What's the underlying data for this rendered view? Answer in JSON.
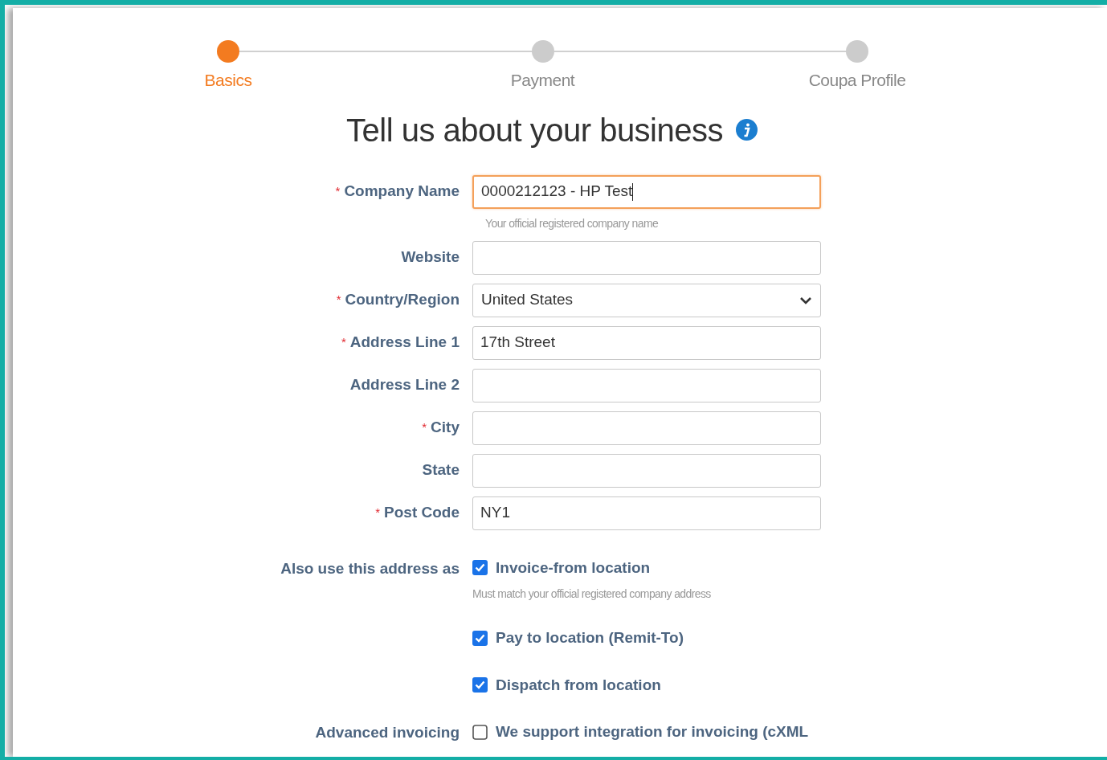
{
  "steps": [
    {
      "label": "Basics",
      "selected": true
    },
    {
      "label": "Payment",
      "selected": false
    },
    {
      "label": "Coupa Profile",
      "selected": false
    }
  ],
  "title": "Tell us about your business",
  "fields": [
    {
      "label": "Company Name",
      "required": true,
      "kind": "text",
      "value": "0000212123 - HP Test",
      "focused": true,
      "hint": "Your official registered company name"
    },
    {
      "label": "Website",
      "required": false,
      "kind": "text",
      "focused": false
    },
    {
      "label": "Country/Region",
      "required": true,
      "kind": "select",
      "value": "United States"
    },
    {
      "label": "Address Line 1",
      "required": true,
      "kind": "text",
      "value": "17th Street",
      "focused": false
    },
    {
      "label": "Address Line 2",
      "required": false,
      "kind": "text",
      "focused": false
    },
    {
      "label": "City",
      "required": true,
      "kind": "text",
      "focused": false
    },
    {
      "label": "State",
      "required": false,
      "kind": "text",
      "focused": false
    },
    {
      "label": "Post Code",
      "required": true,
      "kind": "text",
      "value": "NY1",
      "focused": false
    }
  ],
  "required_mark": "*",
  "checkbox_groups": [
    {
      "label": "Also use this address as",
      "options": [
        {
          "label": "Invoice-from location",
          "checked": true,
          "hint": "Must match your official registered company address"
        },
        {
          "label": "Pay to location (Remit-To)",
          "checked": true
        },
        {
          "label": "Dispatch from location",
          "checked": true
        }
      ]
    },
    {
      "label": "Advanced invoicing",
      "options": [
        {
          "label": "We support integration for invoicing (cXML",
          "checked": false
        }
      ]
    }
  ]
}
